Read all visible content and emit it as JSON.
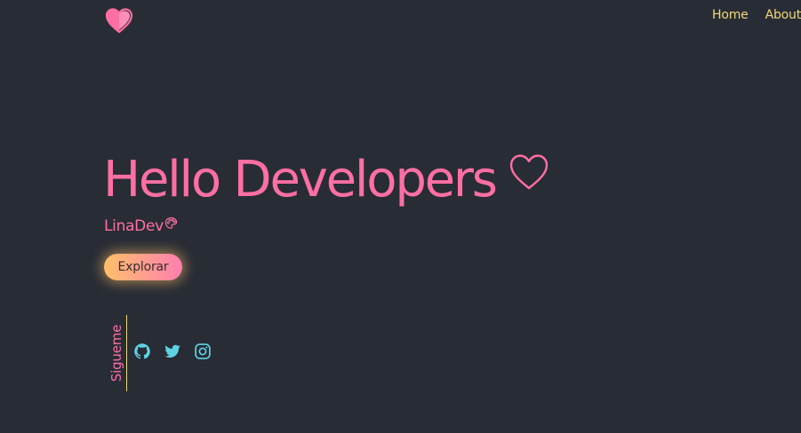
{
  "header": {
    "logo_icon": "half-heart-logo-icon",
    "nav": [
      {
        "label": "Home"
      },
      {
        "label": "About"
      }
    ]
  },
  "hero": {
    "title": "Hello Developers",
    "title_icon": "heart-outline-icon",
    "subtitle": "LinaDev",
    "subtitle_icon": "palette-icon",
    "cta_label": "Explorar"
  },
  "social": {
    "label": "Sigueme",
    "links": [
      {
        "icon": "github-icon"
      },
      {
        "icon": "twitter-icon"
      },
      {
        "icon": "instagram-icon"
      }
    ]
  },
  "colors": {
    "background": "#282c35",
    "accent_pink": "#ff6fa3",
    "accent_yellow": "#f0d97a",
    "social_cyan": "#5fd3e6",
    "button_gradient_start": "#ffc06a",
    "button_gradient_end": "#ff7fb0"
  }
}
